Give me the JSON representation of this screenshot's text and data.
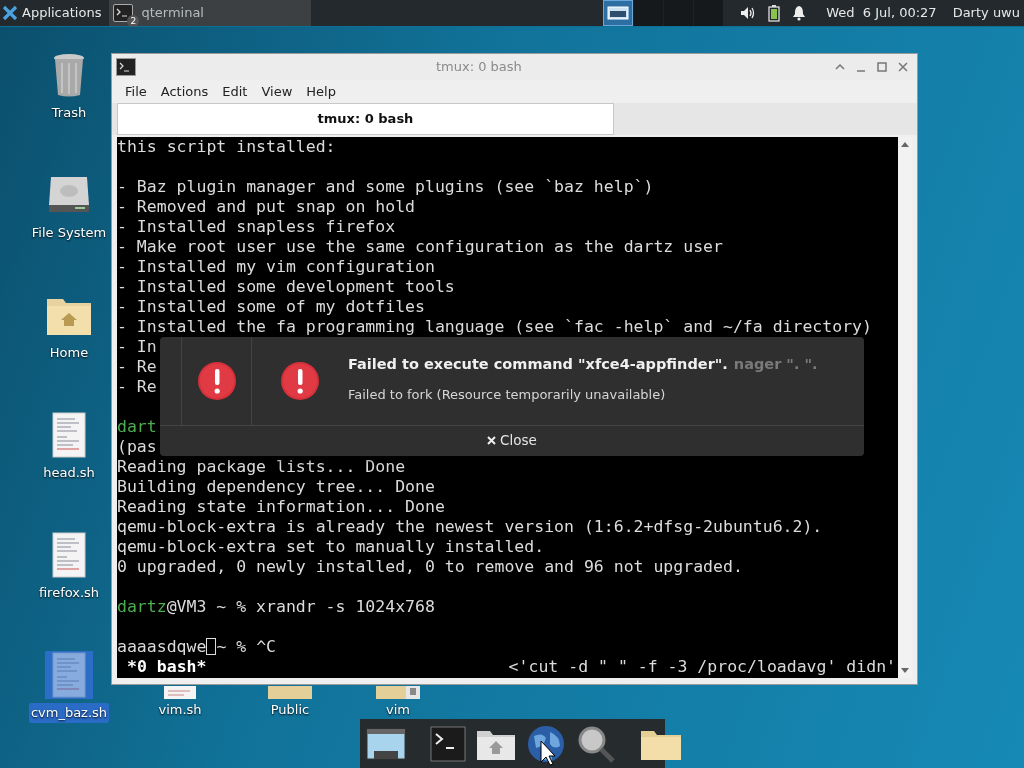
{
  "top_panel": {
    "menu_label": "Applications",
    "tasks": [
      {
        "label": "qterminal",
        "badge": "2",
        "selected": true
      }
    ],
    "workspaces": [
      {
        "selected": true
      },
      {
        "selected": false
      },
      {
        "selected": false
      },
      {
        "selected": false
      }
    ],
    "clock": "Wed  6 Jul, 00:27",
    "user": "Darty uwu"
  },
  "desktop_icons": [
    {
      "label": "Trash",
      "kind": "trash",
      "selected": false
    },
    {
      "label": "File System",
      "kind": "drive",
      "selected": false
    },
    {
      "label": "Home",
      "kind": "home",
      "selected": false
    },
    {
      "label": "head.sh",
      "kind": "script",
      "selected": false
    },
    {
      "label": "firefox.sh",
      "kind": "script",
      "selected": false
    },
    {
      "label": "cvm_baz.sh",
      "kind": "script",
      "selected": true
    }
  ],
  "desktop_bottom_icons": [
    {
      "label": "vim.sh",
      "kind": "script"
    },
    {
      "label": "Public",
      "kind": "folder"
    },
    {
      "label": "vim",
      "kind": "locked-folder"
    }
  ],
  "terminal_window": {
    "title": "tmux: 0 bash",
    "menu": [
      "File",
      "Actions",
      "Edit",
      "View",
      "Help"
    ],
    "tabs": [
      {
        "label": "tmux: 0 bash",
        "selected": true
      }
    ],
    "blocks": [
      {
        "lines": [
          {
            "text": "this script installed:"
          }
        ]
      },
      {
        "lines": [
          {
            "text": "- Baz plugin manager and some plugins (see `baz help`)"
          },
          {
            "text": "- Removed and put snap on hold"
          },
          {
            "text": "- Installed snapless firefox"
          },
          {
            "text": "- Make root user use the same configuration as the dartz user"
          },
          {
            "text": "- Installed my vim configuration"
          },
          {
            "text": "- Installed some development tools"
          },
          {
            "text": "- Installed some of my dotfiles"
          },
          {
            "text": "- Installed the fa programming language (see `fac -help` and ~/fa directory)"
          },
          {
            "text": "- In"
          },
          {
            "text": "- Re"
          },
          {
            "text": "- Re"
          }
        ]
      },
      {
        "lines": [
          {
            "user": "dart"
          },
          {
            "text": "(pas"
          },
          {
            "text": "Reading package lists... Done"
          },
          {
            "text": "Building dependency tree... Done"
          },
          {
            "text": "Reading state information... Done"
          },
          {
            "text": "qemu-block-extra is already the newest version (1:6.2+dfsg-2ubuntu6.2)."
          },
          {
            "text": "qemu-block-extra set to manually installed."
          },
          {
            "text": "0 upgraded, 0 newly installed, 0 to remove and 96 not upgraded."
          }
        ]
      },
      {
        "lines": [
          {
            "user": "dartz",
            "text": "@VM3 ~ % xrandr -s 1024x768"
          }
        ]
      },
      {
        "lines": [
          {
            "text": "aaaasdqwe",
            "cursor": true,
            "after": "~ % ^C"
          }
        ]
      }
    ],
    "status_left": "*0 bash*",
    "status_right": "<'cut -d \" \" -f -3 /proc/loadavg' didn'"
  },
  "notification": {
    "title": "Failed to execute command \"xfce4-appfinder\".",
    "ghost_title": "nager \". \".",
    "body": "Failed to fork (Resource temporarily unavailable)",
    "button": "Close"
  },
  "dock": {
    "items": [
      {
        "kind": "window"
      },
      {
        "kind": "separator"
      },
      {
        "kind": "terminal"
      },
      {
        "kind": "home"
      },
      {
        "kind": "globe"
      },
      {
        "kind": "search"
      },
      {
        "kind": "separator"
      },
      {
        "kind": "folder"
      }
    ]
  }
}
